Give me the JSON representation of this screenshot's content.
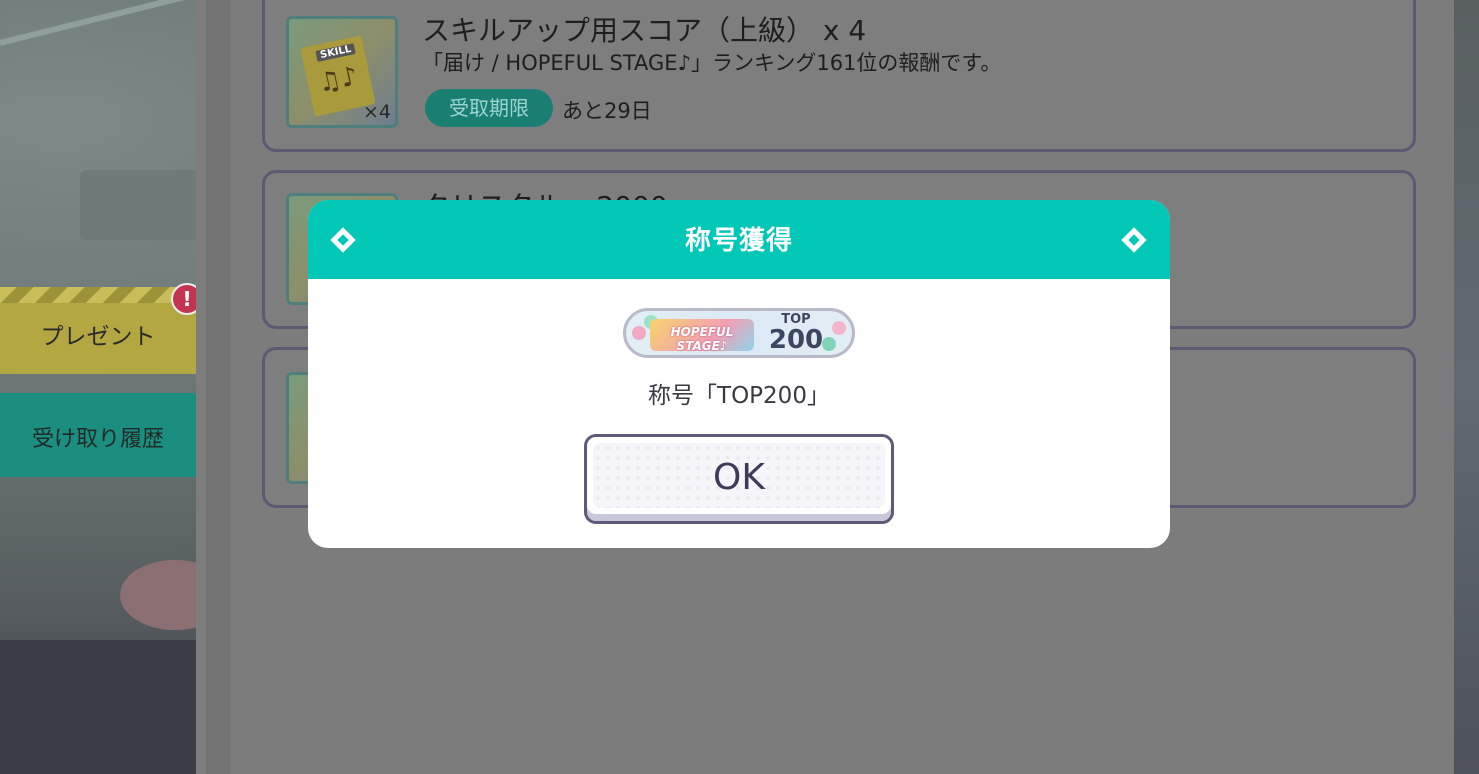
{
  "side_menu": {
    "present_label": "プレゼント",
    "present_badge": "!",
    "history_label": "受け取り履歴"
  },
  "items": [
    {
      "title": "スキルアップ用スコア（上級） x 4",
      "description": "「届け / HOPEFUL STAGE♪」ランキング161位の報酬です。",
      "thumb_count": "×4",
      "thumb_tag": "SKILL",
      "deadline_label": "受取期限",
      "deadline_value": "あと29日"
    },
    {
      "title": "クリスタル x 2000"
    },
    {
      "title": ""
    }
  ],
  "modal": {
    "title": "称号獲得",
    "badge_logo": "HOPEFUL STAGE♪",
    "badge_top": "TOP",
    "badge_rank": "200",
    "reward_name": "称号「TOP200」",
    "ok_label": "OK"
  },
  "colors": {
    "accent": "#00c7b6",
    "present_tab": "#b3a741",
    "history_tab": "#1b8e7f",
    "badge_alert": "#c33451"
  }
}
